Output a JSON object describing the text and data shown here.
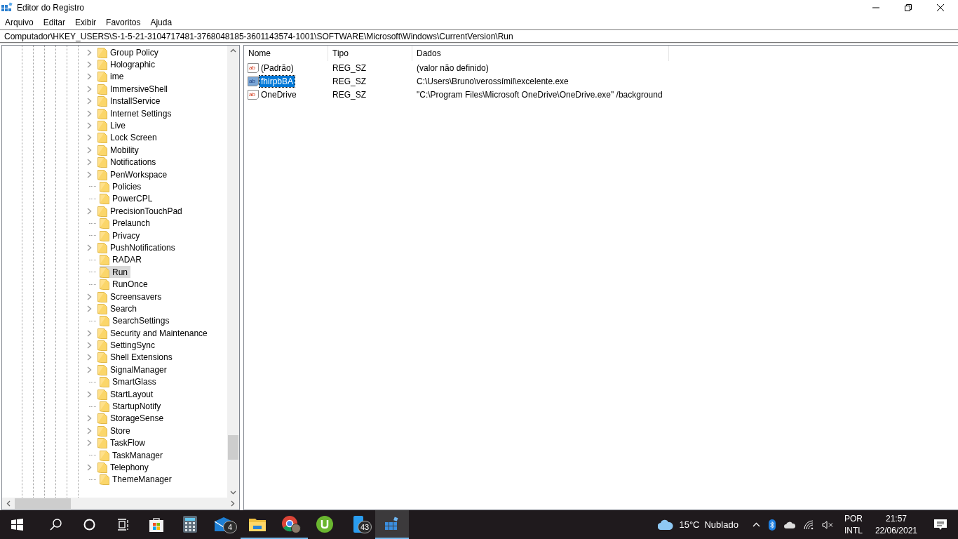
{
  "window": {
    "title": "Editor do Registro"
  },
  "menu": [
    {
      "label": "Arquivo"
    },
    {
      "label": "Editar"
    },
    {
      "label": "Exibir"
    },
    {
      "label": "Favoritos"
    },
    {
      "label": "Ajuda"
    }
  ],
  "address": "Computador\\HKEY_USERS\\S-1-5-21-3104717481-3768048185-3601143574-1001\\SOFTWARE\\Microsoft\\Windows\\CurrentVersion\\Run",
  "tree": [
    {
      "label": "Group Policy",
      "expandable": true,
      "selected": false
    },
    {
      "label": "Holographic",
      "expandable": true,
      "selected": false
    },
    {
      "label": "ime",
      "expandable": true,
      "selected": false
    },
    {
      "label": "ImmersiveShell",
      "expandable": true,
      "selected": false
    },
    {
      "label": "InstallService",
      "expandable": true,
      "selected": false
    },
    {
      "label": "Internet Settings",
      "expandable": true,
      "selected": false
    },
    {
      "label": "Live",
      "expandable": true,
      "selected": false
    },
    {
      "label": "Lock Screen",
      "expandable": true,
      "selected": false
    },
    {
      "label": "Mobility",
      "expandable": true,
      "selected": false
    },
    {
      "label": "Notifications",
      "expandable": true,
      "selected": false
    },
    {
      "label": "PenWorkspace",
      "expandable": true,
      "selected": false
    },
    {
      "label": "Policies",
      "expandable": false,
      "selected": false
    },
    {
      "label": "PowerCPL",
      "expandable": false,
      "selected": false
    },
    {
      "label": "PrecisionTouchPad",
      "expandable": true,
      "selected": false
    },
    {
      "label": "Prelaunch",
      "expandable": false,
      "selected": false
    },
    {
      "label": "Privacy",
      "expandable": false,
      "selected": false
    },
    {
      "label": "PushNotifications",
      "expandable": true,
      "selected": false
    },
    {
      "label": "RADAR",
      "expandable": false,
      "selected": false
    },
    {
      "label": "Run",
      "expandable": false,
      "selected": true
    },
    {
      "label": "RunOnce",
      "expandable": false,
      "selected": false
    },
    {
      "label": "Screensavers",
      "expandable": true,
      "selected": false
    },
    {
      "label": "Search",
      "expandable": true,
      "selected": false
    },
    {
      "label": "SearchSettings",
      "expandable": false,
      "selected": false
    },
    {
      "label": "Security and Maintenance",
      "expandable": true,
      "selected": false
    },
    {
      "label": "SettingSync",
      "expandable": true,
      "selected": false
    },
    {
      "label": "Shell Extensions",
      "expandable": true,
      "selected": false
    },
    {
      "label": "SignalManager",
      "expandable": true,
      "selected": false
    },
    {
      "label": "SmartGlass",
      "expandable": false,
      "selected": false
    },
    {
      "label": "StartLayout",
      "expandable": true,
      "selected": false
    },
    {
      "label": "StartupNotify",
      "expandable": false,
      "selected": false
    },
    {
      "label": "StorageSense",
      "expandable": true,
      "selected": false
    },
    {
      "label": "Store",
      "expandable": true,
      "selected": false
    },
    {
      "label": "TaskFlow",
      "expandable": true,
      "selected": false
    },
    {
      "label": "TaskManager",
      "expandable": false,
      "selected": false
    },
    {
      "label": "Telephony",
      "expandable": true,
      "selected": false
    },
    {
      "label": "ThemeManager",
      "expandable": false,
      "selected": false
    }
  ],
  "table": {
    "columns": [
      "Nome",
      "Tipo",
      "Dados"
    ],
    "rows": [
      {
        "icon": "ab",
        "name": "(Padrão)",
        "type": "REG_SZ",
        "data": "(valor não definido)",
        "selected": false
      },
      {
        "icon": "ab",
        "name": "fhirpbBA",
        "type": "REG_SZ",
        "data": "C:\\Users\\Bruno\\verossímil\\excelente.exe",
        "selected": true
      },
      {
        "icon": "ab",
        "name": "OneDrive",
        "type": "REG_SZ",
        "data": "\"C:\\Program Files\\Microsoft OneDrive\\OneDrive.exe\" /background",
        "selected": false
      }
    ]
  },
  "taskbar": {
    "apps": [
      {
        "kind": "store",
        "running": false,
        "active": false
      },
      {
        "kind": "calculator",
        "running": false,
        "active": false
      },
      {
        "kind": "mail",
        "badge": "4",
        "running": false,
        "active": false
      },
      {
        "kind": "explorer",
        "running": true,
        "active": false
      },
      {
        "kind": "browser",
        "running": true,
        "active": false
      },
      {
        "kind": "torrent",
        "running": false,
        "active": false
      },
      {
        "kind": "phone",
        "badge": "43",
        "running": false,
        "active": false
      },
      {
        "kind": "regedit",
        "running": true,
        "active": true
      }
    ],
    "weather": {
      "temp": "15°C",
      "condition": "Nublado"
    },
    "language": [
      "POR",
      "INTL"
    ],
    "time": "21:57",
    "date": "22/06/2021"
  }
}
